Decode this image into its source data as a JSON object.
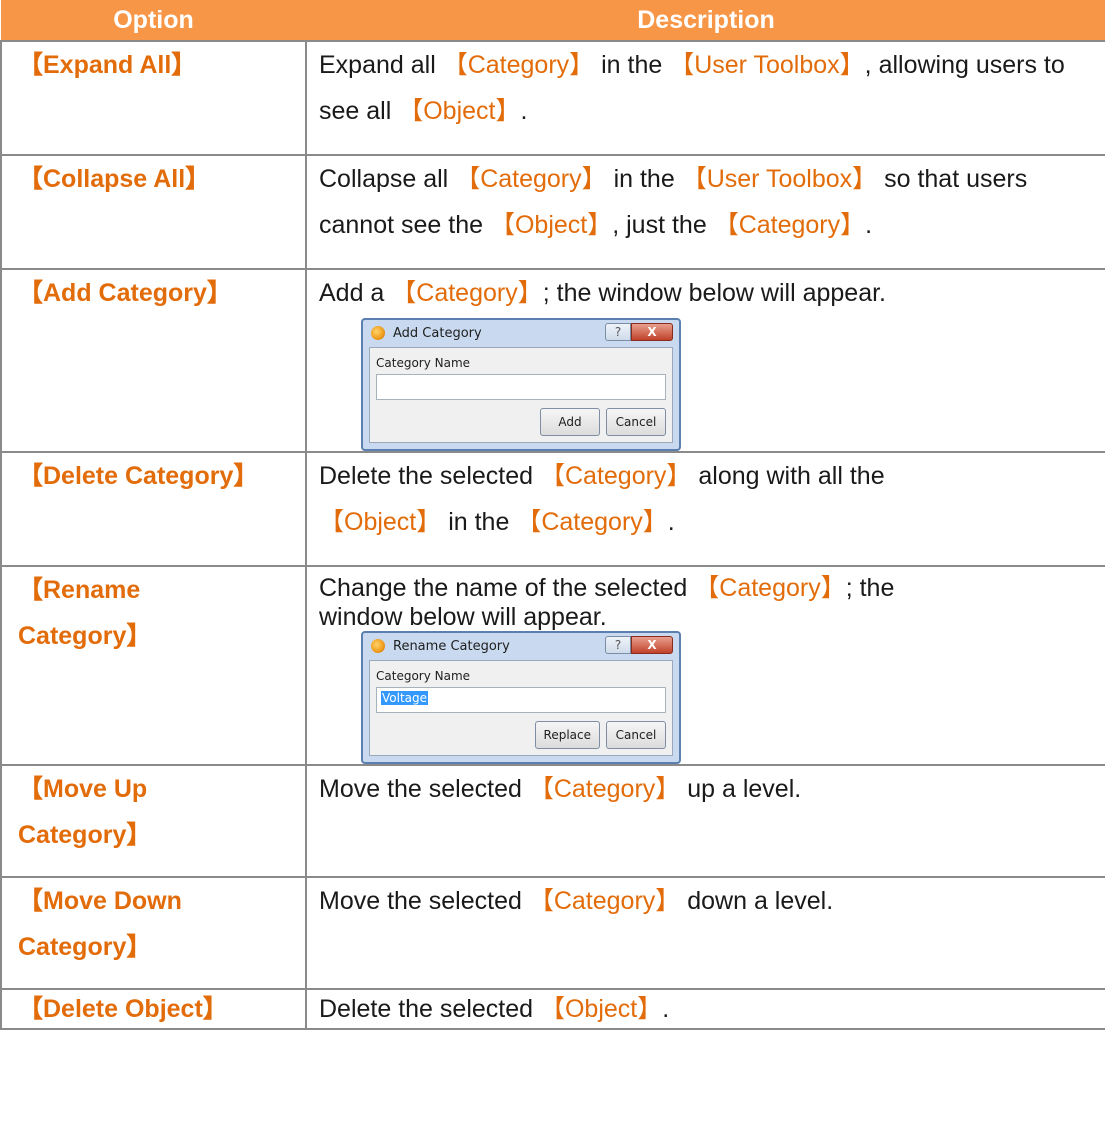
{
  "header": {
    "option": "Option",
    "description": "Description"
  },
  "rows": {
    "expand": {
      "option": "【Expand All】",
      "d": [
        "Expand all ",
        "【Category】",
        " in the ",
        "【User Toolbox】",
        ", allowing users to see all ",
        "【Object】",
        "."
      ]
    },
    "collapse": {
      "option": "【Collapse All】",
      "d": [
        "Collapse all ",
        "【Category】",
        " in the ",
        "【User Toolbox】",
        " so that users cannot see the ",
        "【Object】",
        ", just the ",
        "【Category】",
        "."
      ]
    },
    "add": {
      "option": "【Add Category】",
      "d": [
        "Add a ",
        "【Category】",
        "; the window below will appear."
      ]
    },
    "delete": {
      "option": "【Delete Category】",
      "d": [
        "Delete the selected ",
        "【Category】",
        " along with all the ",
        "【Object】",
        " in the ",
        "【Category】",
        "."
      ]
    },
    "rename": {
      "option_line1": "【Rename",
      "option_line2": "Category】",
      "d": [
        "Change the name of the selected ",
        "【Category】",
        "; the"
      ],
      "d2": "window below will appear."
    },
    "moveup": {
      "option_line1": "【Move Up",
      "option_line2": "Category】",
      "d": [
        "Move the selected ",
        "【Category】",
        " up a level."
      ]
    },
    "movedown": {
      "option_line1": "【Move Down",
      "option_line2": "Category】",
      "d": [
        "Move the selected ",
        "【Category】",
        " down a level."
      ]
    },
    "delobj": {
      "option": "【Delete Object】",
      "d": [
        "Delete the selected ",
        "【Object】",
        "."
      ]
    }
  },
  "dialogs": {
    "add": {
      "title": "Add Category",
      "label": "Category Name",
      "value": "",
      "primary_button": "Add",
      "cancel_button": "Cancel"
    },
    "rename": {
      "title": "Rename Category",
      "label": "Category Name",
      "value": "Voltage",
      "primary_button": "Replace",
      "cancel_button": "Cancel"
    },
    "help_glyph": "?",
    "close_glyph": "X"
  },
  "colors": {
    "header_bg": "#f79646",
    "accent": "#e36c0a",
    "grid": "#8a8a8a"
  }
}
